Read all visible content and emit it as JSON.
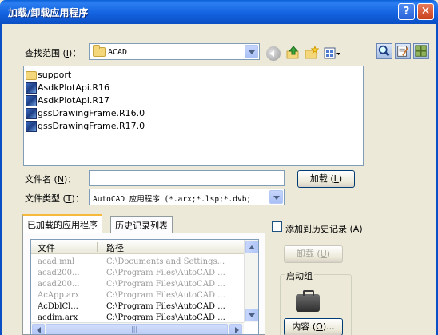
{
  "window": {
    "title": "加载/卸载应用程序",
    "help_glyph": "?",
    "close_glyph": "✕"
  },
  "look_in": {
    "label_pre": "查找范围 (",
    "label_key": "I",
    "label_post": ")：",
    "value": "ACAD"
  },
  "files": [
    {
      "name": "support",
      "icon": "folder-icon"
    },
    {
      "name": "AsdkPlotApi.R16",
      "icon": "arx-file-icon"
    },
    {
      "name": "AsdkPlotApi.R17",
      "icon": "arx-file-icon"
    },
    {
      "name": "gssDrawingFrame.R16.0",
      "icon": "arx-file-icon"
    },
    {
      "name": "gssDrawingFrame.R17.0",
      "icon": "arx-file-icon"
    }
  ],
  "filename": {
    "label_pre": "文件名 (",
    "label_key": "N",
    "label_post": ")：",
    "value": ""
  },
  "filetype": {
    "label_pre": "文件类型 (",
    "label_key": "T",
    "label_post": ")：",
    "value": "AutoCAD 应用程序 (*.arx;*.lsp;*.dvb;"
  },
  "load_button": {
    "label": "加载 (",
    "key": "L",
    "post": ")"
  },
  "tabs": [
    {
      "label": "已加载的应用程序"
    },
    {
      "label": "历史记录列表"
    }
  ],
  "add_history": {
    "label": "添加到历史记录 (",
    "key": "A",
    "post": ")"
  },
  "loaded_table": {
    "headers": [
      "文件",
      "路径"
    ],
    "rows": [
      {
        "file": "acad.mnl",
        "path": "C:\\Documents and Settings...",
        "dim": true
      },
      {
        "file": "acad200...",
        "path": "C:\\Program Files\\AutoCAD ...",
        "dim": true
      },
      {
        "file": "acad200...",
        "path": "C:\\Program Files\\AutoCAD ...",
        "dim": true
      },
      {
        "file": "AcApp.arx",
        "path": "C:\\Program Files\\AutoCAD ...",
        "dim": true
      },
      {
        "file": "AcDblCl...",
        "path": "C:\\Program Files\\AutoCAD ...",
        "dim": false
      },
      {
        "file": "acdim.arx",
        "path": "C:\\Program Files\\AutoCAD ...",
        "dim": false
      }
    ],
    "hscroll_glyph": "|||"
  },
  "unload_button": {
    "label": "卸载 (",
    "key": "U",
    "post": ")"
  },
  "startup_group": {
    "label": "启动组"
  },
  "contents_button": {
    "label": "内容 (",
    "key": "O",
    "post": ")..."
  }
}
